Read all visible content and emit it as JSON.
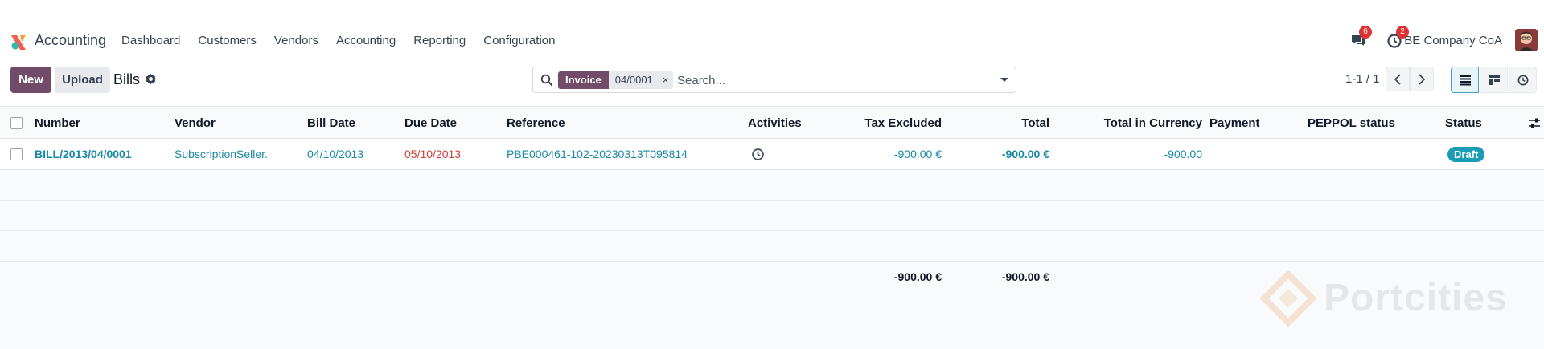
{
  "navbar": {
    "app_name": "Accounting",
    "menu": [
      {
        "label": "Dashboard"
      },
      {
        "label": "Customers"
      },
      {
        "label": "Vendors"
      },
      {
        "label": "Accounting"
      },
      {
        "label": "Reporting"
      },
      {
        "label": "Configuration"
      }
    ],
    "messages_count": "6",
    "activities_count": "2",
    "company": "BE Company CoA"
  },
  "control": {
    "new_label": "New",
    "upload_label": "Upload",
    "title": "Bills",
    "search": {
      "facet_label": "Invoice",
      "facet_value": "04/0001",
      "facet_remove": "×",
      "placeholder": "Search..."
    },
    "pager": "1-1 / 1"
  },
  "table": {
    "columns": {
      "number": "Number",
      "vendor": "Vendor",
      "bill_date": "Bill Date",
      "due_date": "Due Date",
      "reference": "Reference",
      "activities": "Activities",
      "tax_excluded": "Tax Excluded",
      "total": "Total",
      "total_currency": "Total in Currency",
      "payment": "Payment",
      "peppol": "PEPPOL status",
      "status": "Status"
    },
    "rows": [
      {
        "number": "BILL/2013/04/0001",
        "vendor": "SubscriptionSeller.",
        "bill_date": "04/10/2013",
        "due_date": "05/10/2013",
        "reference": "PBE000461-102-20230313T095814",
        "tax_excluded": "-900.00 €",
        "total": "-900.00 €",
        "total_currency": "-900.00",
        "payment": "",
        "peppol": "",
        "status": "Draft"
      }
    ],
    "footer": {
      "tax_excluded": "-900.00 €",
      "total": "-900.00 €"
    }
  },
  "watermark": "Portcities",
  "colors": {
    "brand": "#714b67",
    "link": "#1a89a5",
    "danger": "#d23f3a",
    "status_draft": "#1a9cb5",
    "badge": "#e03131"
  },
  "icons": {
    "app": "accounting-app-icon",
    "messages": "chat-icon",
    "activities": "clock-icon",
    "settings": "gear-icon",
    "search": "search-icon",
    "list_view": "list-view-icon",
    "kanban_view": "kanban-view-icon",
    "activity_view": "activity-view-icon",
    "optional_columns": "sliders-icon"
  }
}
